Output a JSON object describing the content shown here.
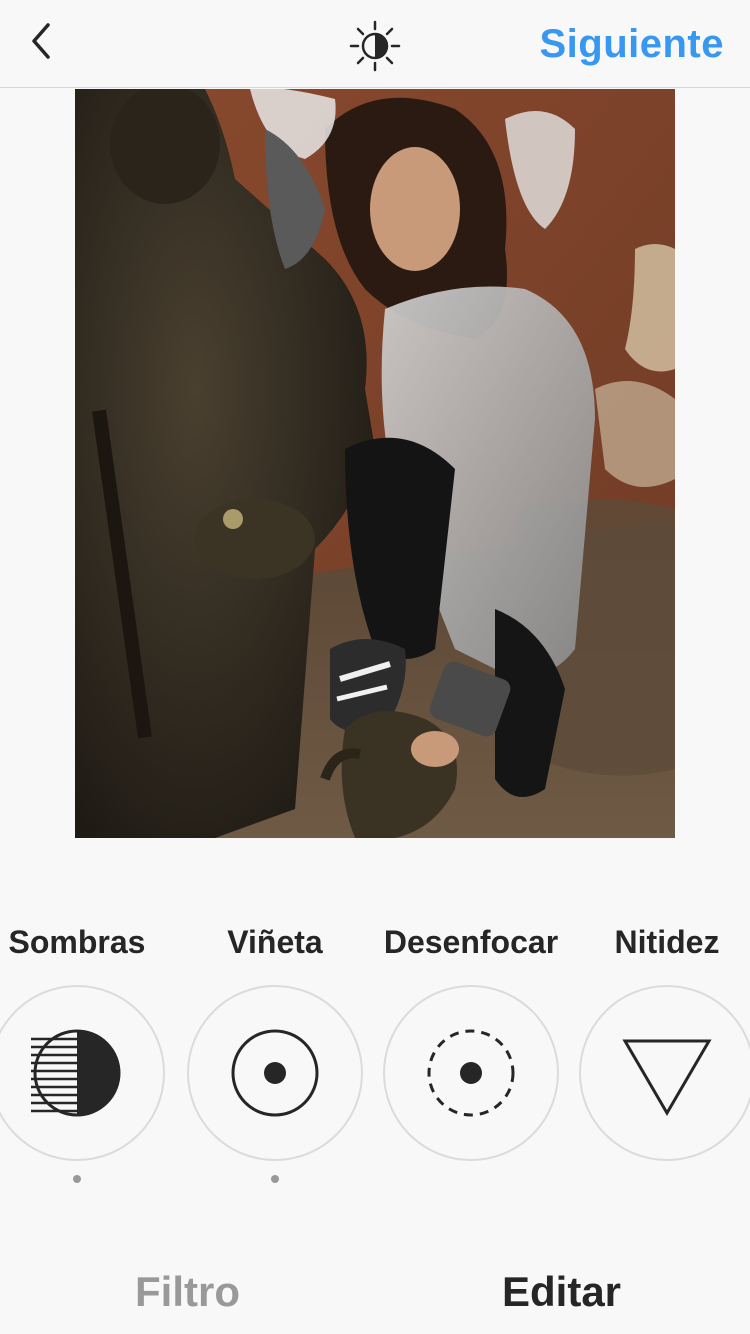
{
  "header": {
    "back_icon": "chevron-left-icon",
    "lux_icon": "lux-sun-icon",
    "next_label": "Siguiente"
  },
  "photo": {
    "description_icon": "photo"
  },
  "tools": [
    {
      "label": "Sombras",
      "icon": "shadows-icon",
      "adjusted": true
    },
    {
      "label": "Viñeta",
      "icon": "vignette-icon",
      "adjusted": true
    },
    {
      "label": "Desenfocar",
      "icon": "tilt-shift-icon",
      "adjusted": false
    },
    {
      "label": "Nitidez",
      "icon": "sharpen-icon",
      "adjusted": false
    }
  ],
  "tabs": {
    "filter_label": "Filtro",
    "edit_label": "Editar",
    "active": "Editar"
  },
  "colors": {
    "accent": "#3897f0",
    "text": "#262626",
    "muted": "#999999"
  }
}
